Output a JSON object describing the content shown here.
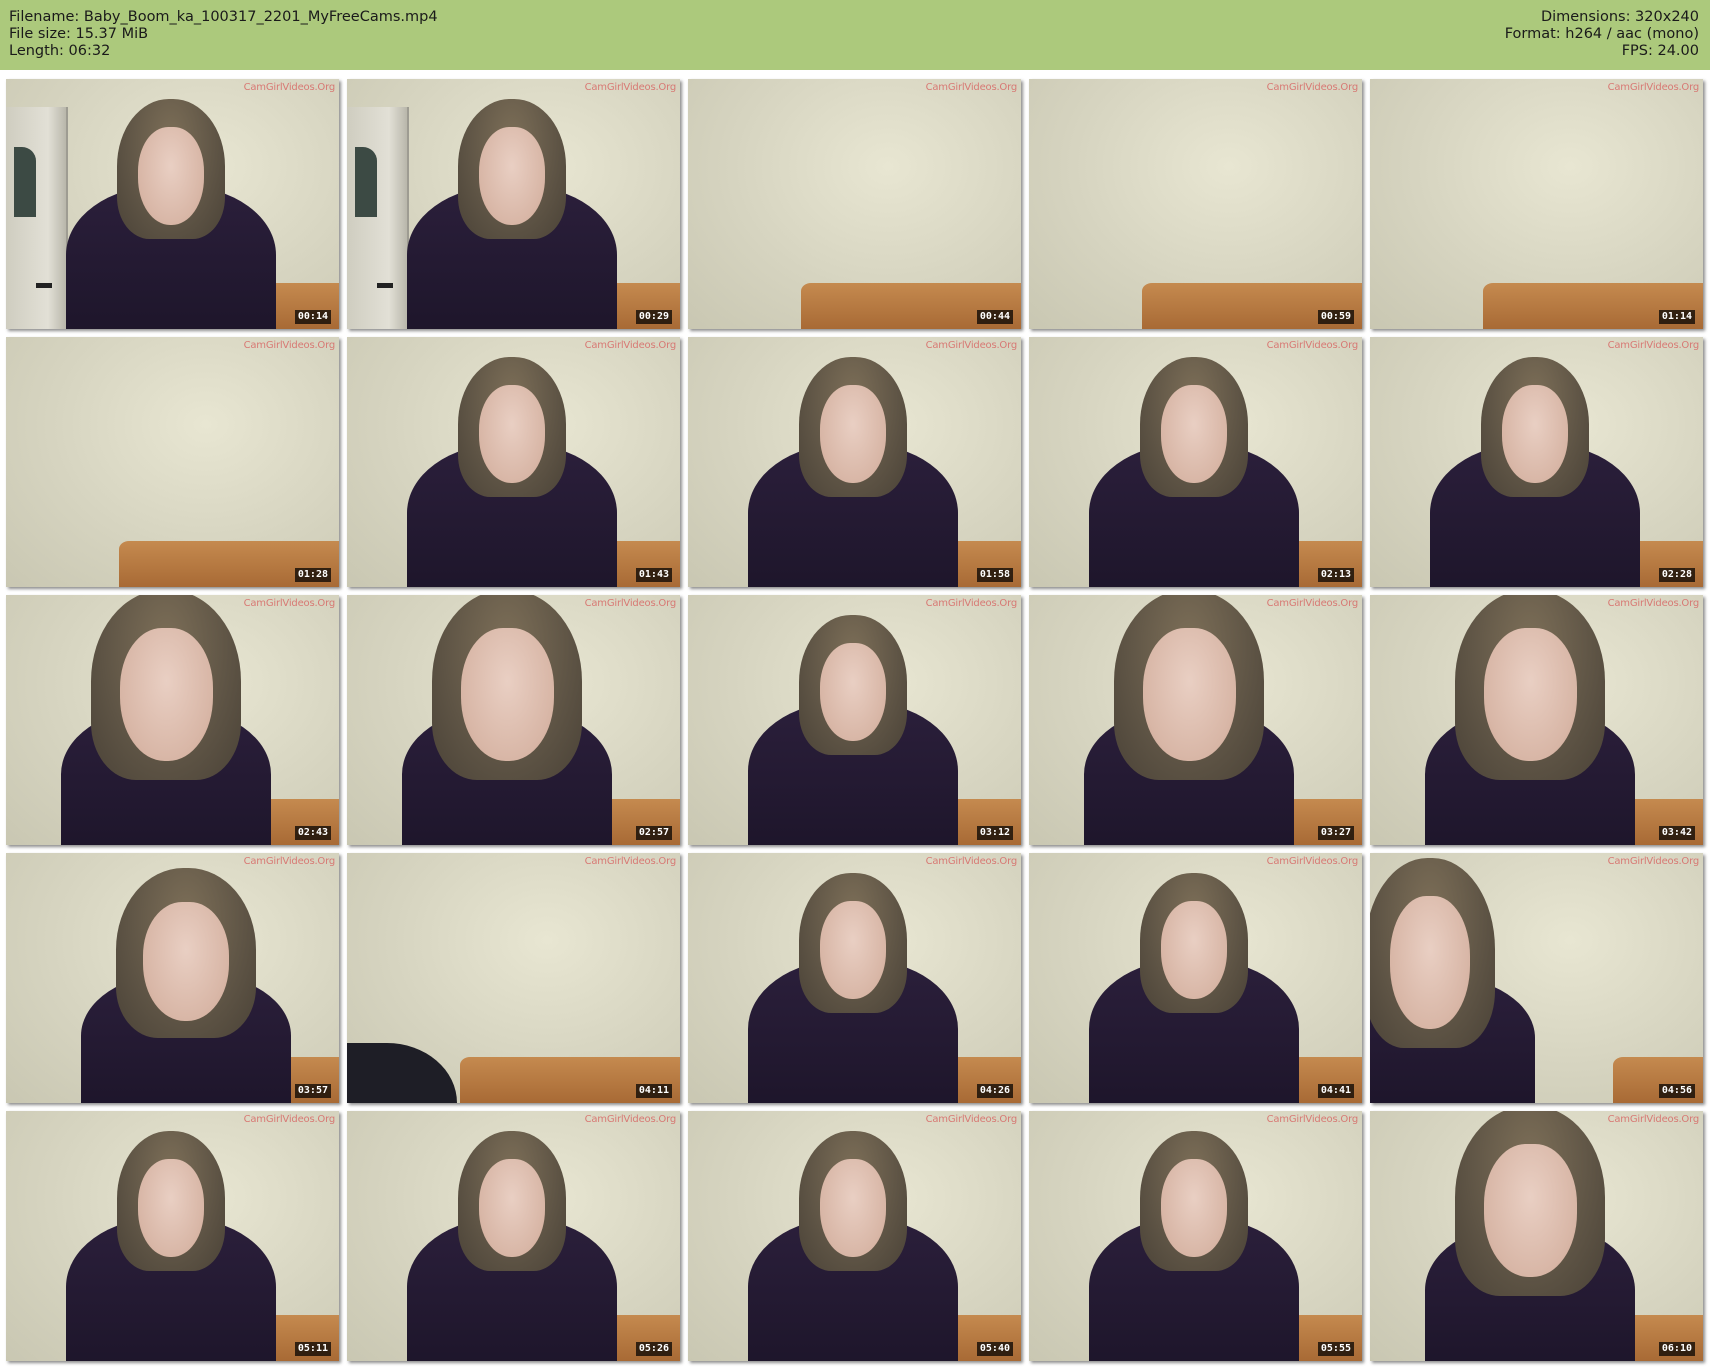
{
  "header": {
    "filename_label": "Filename: Baby_Boom_ka_100317_2201_MyFreeCams.mp4",
    "filesize_label": "File size: 15.37 MiB",
    "length_label": "Length: 06:32",
    "dimensions_label": "Dimensions: 320x240",
    "format_label": "Format: h264 / aac (mono)",
    "fps_label": "FPS: 24.00",
    "background_color": "#acc97c"
  },
  "watermark": "CamGirlVideos.Org",
  "thumbnails": [
    {
      "time": "00:14",
      "scene": "person-door"
    },
    {
      "time": "00:29",
      "scene": "person-door"
    },
    {
      "time": "00:44",
      "scene": "empty"
    },
    {
      "time": "00:59",
      "scene": "empty"
    },
    {
      "time": "01:14",
      "scene": "empty"
    },
    {
      "time": "01:28",
      "scene": "empty"
    },
    {
      "time": "01:43",
      "scene": "person"
    },
    {
      "time": "01:58",
      "scene": "person"
    },
    {
      "time": "02:13",
      "scene": "person-hand"
    },
    {
      "time": "02:28",
      "scene": "person-hand"
    },
    {
      "time": "02:43",
      "scene": "person-close"
    },
    {
      "time": "02:57",
      "scene": "person-close"
    },
    {
      "time": "03:12",
      "scene": "person"
    },
    {
      "time": "03:27",
      "scene": "person-close"
    },
    {
      "time": "03:42",
      "scene": "person-close"
    },
    {
      "time": "03:57",
      "scene": "person-tilt"
    },
    {
      "time": "04:11",
      "scene": "empty-chair"
    },
    {
      "time": "04:26",
      "scene": "person"
    },
    {
      "time": "04:41",
      "scene": "person"
    },
    {
      "time": "04:56",
      "scene": "person-left"
    },
    {
      "time": "05:11",
      "scene": "person"
    },
    {
      "time": "05:26",
      "scene": "person"
    },
    {
      "time": "05:40",
      "scene": "person"
    },
    {
      "time": "05:55",
      "scene": "person"
    },
    {
      "time": "06:10",
      "scene": "person-close"
    }
  ]
}
